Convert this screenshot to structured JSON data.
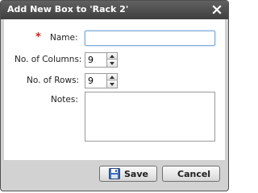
{
  "dialog": {
    "title": "Add New Box to 'Rack 2'",
    "close_icon": "close-icon"
  },
  "form": {
    "required_mark": "*",
    "name": {
      "label": "Name:",
      "value": ""
    },
    "columns": {
      "label": "No. of Columns:",
      "value": "9"
    },
    "rows": {
      "label": "No. of Rows:",
      "value": "9"
    },
    "notes": {
      "label": "Notes:",
      "value": ""
    }
  },
  "buttons": {
    "save_label": "Save",
    "save_icon": "floppy-disk-icon",
    "cancel_label": "Cancel"
  },
  "colors": {
    "titlebar": "#4f4f4f",
    "dialog_background": "#d2d2d2",
    "required_star": "#d41c1c",
    "focus_border": "#7eaad8"
  }
}
